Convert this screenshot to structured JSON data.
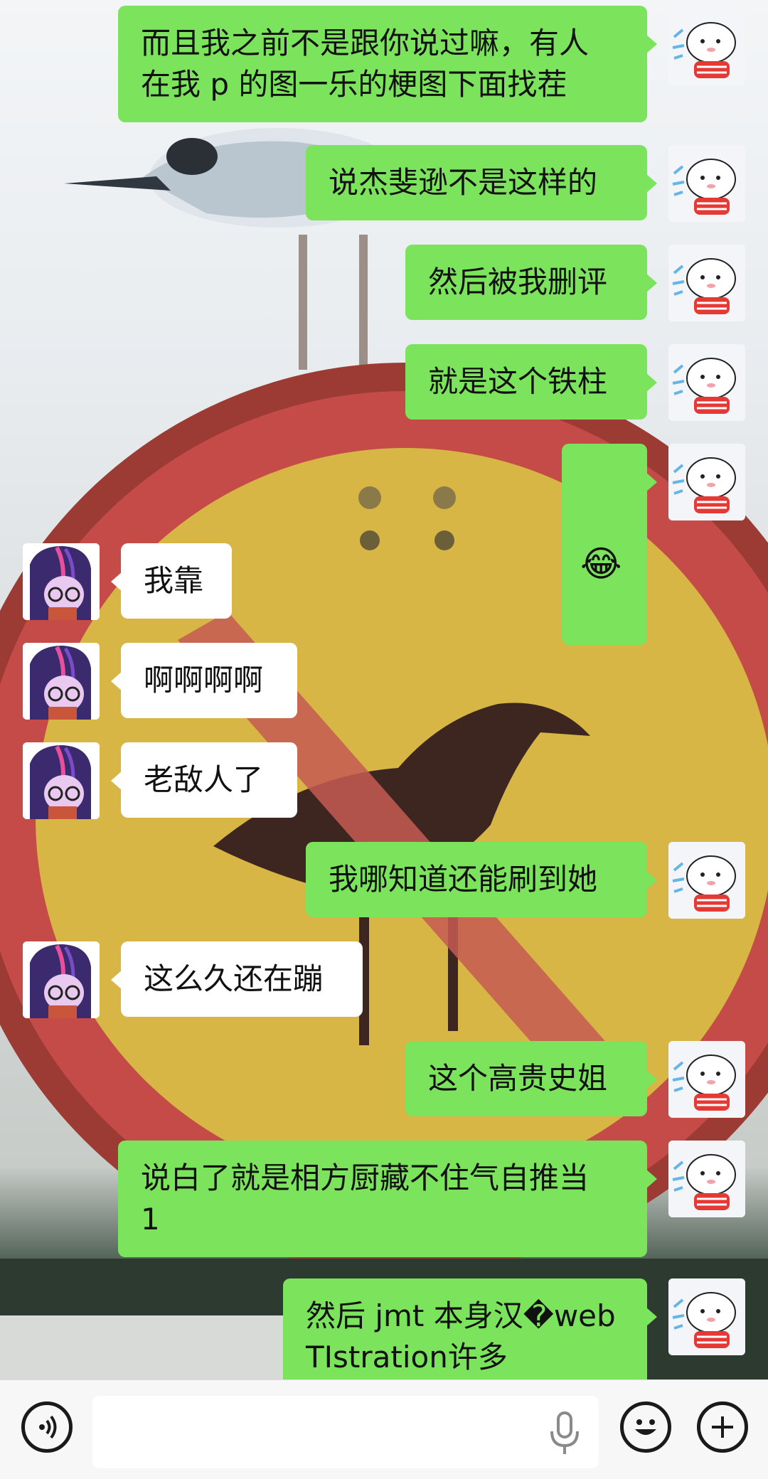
{
  "messages": [
    {
      "side": "me",
      "text": "而且我之前不是跟你说过嘛，有人\n在我 p 的图一乐的梗图下面找茬"
    },
    {
      "side": "me",
      "text": "说杰斐逊不是这样的"
    },
    {
      "side": "me",
      "text": "然后被我删评"
    },
    {
      "side": "me",
      "text": "就是这个铁柱"
    },
    {
      "side": "me",
      "text": "😂",
      "emoji": true
    },
    {
      "side": "them",
      "text": "我靠"
    },
    {
      "side": "them",
      "text": "啊啊啊啊"
    },
    {
      "side": "them",
      "text": "老敌人了"
    },
    {
      "side": "me",
      "text": "我哪知道还能刷到她"
    },
    {
      "side": "them",
      "text": "这么久还在蹦"
    },
    {
      "side": "me",
      "text": "这个高贵史姐"
    },
    {
      "side": "me",
      "text": "说白了就是相方厨藏不住气自推当\n1"
    },
    {
      "side": "me",
      "text": "然后 jmt 本身汉�webTIstration许多"
    }
  ],
  "input_bar": {
    "voice_icon": "voice-wave-icon",
    "mic_icon": "microphone-icon",
    "emoji_icon": "smiley-face-icon",
    "plus_icon": "plus-circle-icon",
    "input_value": ""
  },
  "colors": {
    "my_bubble": "#7ce35c",
    "their_bubble": "#ffffff",
    "input_bar": "#f7f7f7"
  }
}
